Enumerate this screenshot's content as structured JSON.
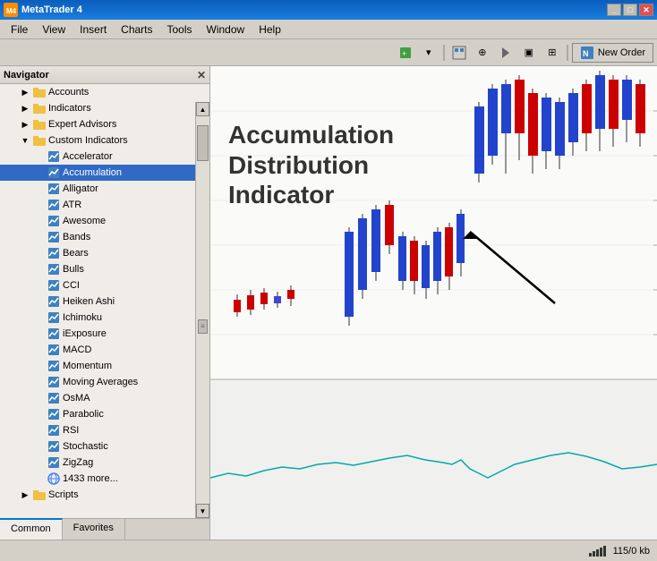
{
  "titleBar": {
    "title": "MetaTrader 4",
    "icon": "MT",
    "controls": [
      "minimize",
      "maximize",
      "close"
    ]
  },
  "menuBar": {
    "items": [
      "File",
      "View",
      "Insert",
      "Charts",
      "Tools",
      "Window",
      "Help"
    ]
  },
  "toolbar": {
    "newOrderLabel": "New Order"
  },
  "navigator": {
    "title": "Navigator",
    "tree": {
      "items": [
        {
          "id": "accounts",
          "label": "Accounts",
          "level": 1,
          "type": "folder",
          "expanded": false
        },
        {
          "id": "indicators",
          "label": "Indicators",
          "level": 1,
          "type": "folder",
          "expanded": false
        },
        {
          "id": "expert-advisors",
          "label": "Expert Advisors",
          "level": 1,
          "type": "folder",
          "expanded": false
        },
        {
          "id": "custom-indicators",
          "label": "Custom Indicators",
          "level": 1,
          "type": "folder",
          "expanded": true
        },
        {
          "id": "accelerator",
          "label": "Accelerator",
          "level": 2,
          "type": "indicator"
        },
        {
          "id": "accumulation",
          "label": "Accumulation",
          "level": 2,
          "type": "indicator",
          "selected": true
        },
        {
          "id": "alligator",
          "label": "Alligator",
          "level": 2,
          "type": "indicator"
        },
        {
          "id": "atr",
          "label": "ATR",
          "level": 2,
          "type": "indicator"
        },
        {
          "id": "awesome",
          "label": "Awesome",
          "level": 2,
          "type": "indicator"
        },
        {
          "id": "bands",
          "label": "Bands",
          "level": 2,
          "type": "indicator"
        },
        {
          "id": "bears",
          "label": "Bears",
          "level": 2,
          "type": "indicator"
        },
        {
          "id": "bulls",
          "label": "Bulls",
          "level": 2,
          "type": "indicator"
        },
        {
          "id": "cci",
          "label": "CCI",
          "level": 2,
          "type": "indicator"
        },
        {
          "id": "heiken-ashi",
          "label": "Heiken Ashi",
          "level": 2,
          "type": "indicator"
        },
        {
          "id": "ichimoku",
          "label": "Ichimoku",
          "level": 2,
          "type": "indicator"
        },
        {
          "id": "iexposure",
          "label": "iExposure",
          "level": 2,
          "type": "indicator"
        },
        {
          "id": "macd",
          "label": "MACD",
          "level": 2,
          "type": "indicator"
        },
        {
          "id": "momentum",
          "label": "Momentum",
          "level": 2,
          "type": "indicator"
        },
        {
          "id": "moving-averages",
          "label": "Moving Averages",
          "level": 2,
          "type": "indicator"
        },
        {
          "id": "osma",
          "label": "OsMA",
          "level": 2,
          "type": "indicator"
        },
        {
          "id": "parabolic",
          "label": "Parabolic",
          "level": 2,
          "type": "indicator"
        },
        {
          "id": "rsi",
          "label": "RSI",
          "level": 2,
          "type": "indicator"
        },
        {
          "id": "stochastic",
          "label": "Stochastic",
          "level": 2,
          "type": "indicator"
        },
        {
          "id": "zigzag",
          "label": "ZigZag",
          "level": 2,
          "type": "indicator"
        },
        {
          "id": "more",
          "label": "1433 more...",
          "level": 2,
          "type": "globe"
        },
        {
          "id": "scripts",
          "label": "Scripts",
          "level": 1,
          "type": "folder",
          "expanded": false
        }
      ]
    },
    "tabs": [
      {
        "id": "common",
        "label": "Common",
        "active": true
      },
      {
        "id": "favorites",
        "label": "Favorites",
        "active": false
      }
    ]
  },
  "annotation": {
    "line1": "Accumulation",
    "line2": "Distribution",
    "line3": "Indicator"
  },
  "statusBar": {
    "memoryUsage": "115/0 kb"
  }
}
